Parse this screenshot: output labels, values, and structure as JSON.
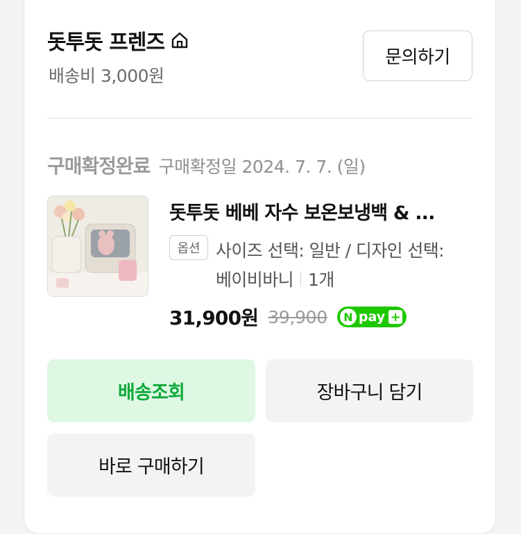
{
  "store": {
    "name": "돗투돗 프렌즈",
    "home_icon": "home-icon",
    "shipping": "배송비 3,000원",
    "inquiry_label": "문의하기"
  },
  "order": {
    "status": "구매확정완료",
    "confirm_date": "구매확정일 2024. 7. 7. (일)"
  },
  "product": {
    "title": "돗투돗 베베 자수 보온보냉백 & ...",
    "option_badge": "옵션",
    "option_line1": "사이즈 선택: 일반 / 디자인 선택:",
    "option_line2": "베이비바니",
    "quantity": "1개",
    "price": "31,900원",
    "original_price": "39,900",
    "npay_n": "N",
    "npay_text": "pay"
  },
  "actions": {
    "track_label": "배송조회",
    "cart_label": "장바구니 담기",
    "buy_label": "바로 구매하기"
  },
  "colors": {
    "accent_green": "#0ea83b",
    "track_bg": "#def8e4",
    "npay_green": "#1ec800"
  }
}
